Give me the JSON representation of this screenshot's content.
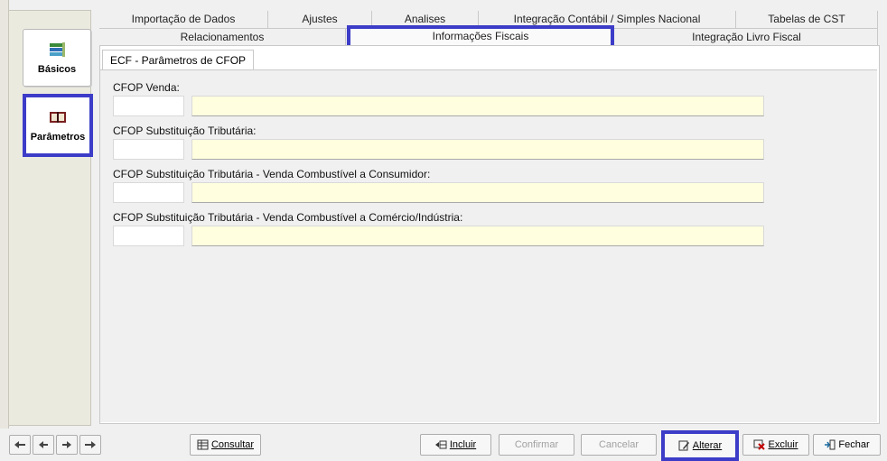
{
  "side_nav": {
    "items": [
      {
        "label": "Básicos",
        "icon": "basics-stack-icon"
      },
      {
        "label": "Parâmetros",
        "icon": "parameters-book-icon"
      }
    ]
  },
  "tabs": {
    "row1": [
      "Importação de Dados",
      "Ajustes",
      "Analises",
      "Integração Contábil / Simples Nacional",
      "Tabelas de CST"
    ],
    "row2": [
      "Relacionamentos",
      "Informações Fiscais",
      "Integração Livro Fiscal"
    ],
    "active": "Informações Fiscais"
  },
  "subtab": "ECF - Parâmetros de CFOP",
  "fields": [
    {
      "label": "CFOP Venda:",
      "code": "",
      "description": ""
    },
    {
      "label": "CFOP Substituição Tributária:",
      "code": "",
      "description": ""
    },
    {
      "label": "CFOP  Substituição Tributária  - Venda Combustível a Consumidor:",
      "code": "",
      "description": ""
    },
    {
      "label": "CFOP  Substituição Tributária  - Venda Combustível a Comércio/Indústria:",
      "code": "",
      "description": ""
    }
  ],
  "toolbar": {
    "consultar": "Consultar",
    "incluir": "Incluir",
    "confirmar": "Confirmar",
    "cancelar": "Cancelar",
    "alterar": "Alterar",
    "excluir": "Excluir",
    "fechar": "Fechar"
  },
  "nav_icons": [
    "first-icon",
    "previous-icon",
    "next-icon",
    "last-icon"
  ],
  "colors": {
    "highlight": "#3c3cc8",
    "lookup_field": "#ffffe0"
  }
}
